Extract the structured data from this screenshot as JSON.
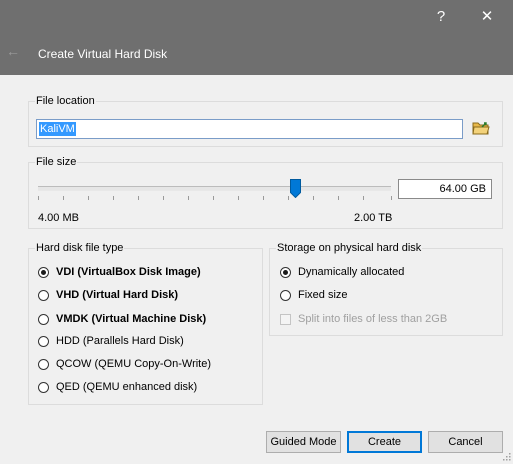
{
  "window": {
    "title": "Create Virtual Hard Disk",
    "help_glyph": "?",
    "close_glyph": "✕",
    "back_glyph": "←"
  },
  "file_location": {
    "label": "File location",
    "value": "KaliVM",
    "folder_icon": "folder-icon"
  },
  "file_size": {
    "label": "File size",
    "value": "64.00 GB",
    "min_label": "4.00 MB",
    "max_label": "2.00 TB",
    "slider_fraction": 0.73
  },
  "disk_type": {
    "label": "Hard disk file type",
    "options": [
      {
        "label": "VDI (VirtualBox Disk Image)",
        "selected": true
      },
      {
        "label": "VHD (Virtual Hard Disk)",
        "selected": false
      },
      {
        "label": "VMDK (Virtual Machine Disk)",
        "selected": false
      },
      {
        "label": "HDD (Parallels Hard Disk)",
        "selected": false
      },
      {
        "label": "QCOW (QEMU Copy-On-Write)",
        "selected": false
      },
      {
        "label": "QED (QEMU enhanced disk)",
        "selected": false
      }
    ]
  },
  "storage": {
    "label": "Storage on physical hard disk",
    "options": [
      {
        "label": "Dynamically allocated",
        "selected": true
      },
      {
        "label": "Fixed size",
        "selected": false
      }
    ],
    "split_label": "Split into files of less than 2GB",
    "split_checked": false,
    "split_enabled": false
  },
  "buttons": {
    "guided": "Guided Mode",
    "create": "Create",
    "cancel": "Cancel"
  },
  "colors": {
    "titlebar": "#6f6f6f",
    "accent": "#0078d7",
    "selection": "#3399ff"
  }
}
